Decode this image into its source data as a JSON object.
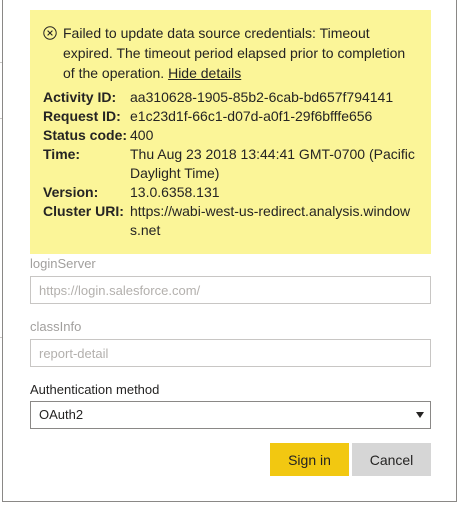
{
  "error": {
    "message": "Failed to update data source credentials: Timeout expired. The timeout period elapsed prior to completion of the operation.",
    "hide_details_label": "Hide details",
    "details": [
      {
        "label": "Activity ID:",
        "value": "aa310628-1905-85b2-6cab-bd657f794141"
      },
      {
        "label": "Request ID:",
        "value": "e1c23d1f-66c1-d07d-a0f1-29f6bfffe656"
      },
      {
        "label": "Status code:",
        "value": "400"
      },
      {
        "label": "Time:",
        "value": "Thu Aug 23 2018 13:44:41 GMT-0700 (Pacific Daylight Time)"
      },
      {
        "label": "Version:",
        "value": "13.0.6358.131"
      },
      {
        "label": "Cluster URI:",
        "value": "https://wabi-west-us-redirect.analysis.windows.net"
      }
    ],
    "panel_color": "#fbf598",
    "icon": "error-circle-x-icon"
  },
  "form": {
    "login_server": {
      "label": "loginServer",
      "placeholder": "https://login.salesforce.com/"
    },
    "class_info": {
      "label": "classInfo",
      "placeholder": "report-detail"
    },
    "auth_method": {
      "label": "Authentication method",
      "selected": "OAuth2"
    }
  },
  "actions": {
    "sign_in_label": "Sign in",
    "cancel_label": "Cancel",
    "primary_color": "#f2c811"
  }
}
